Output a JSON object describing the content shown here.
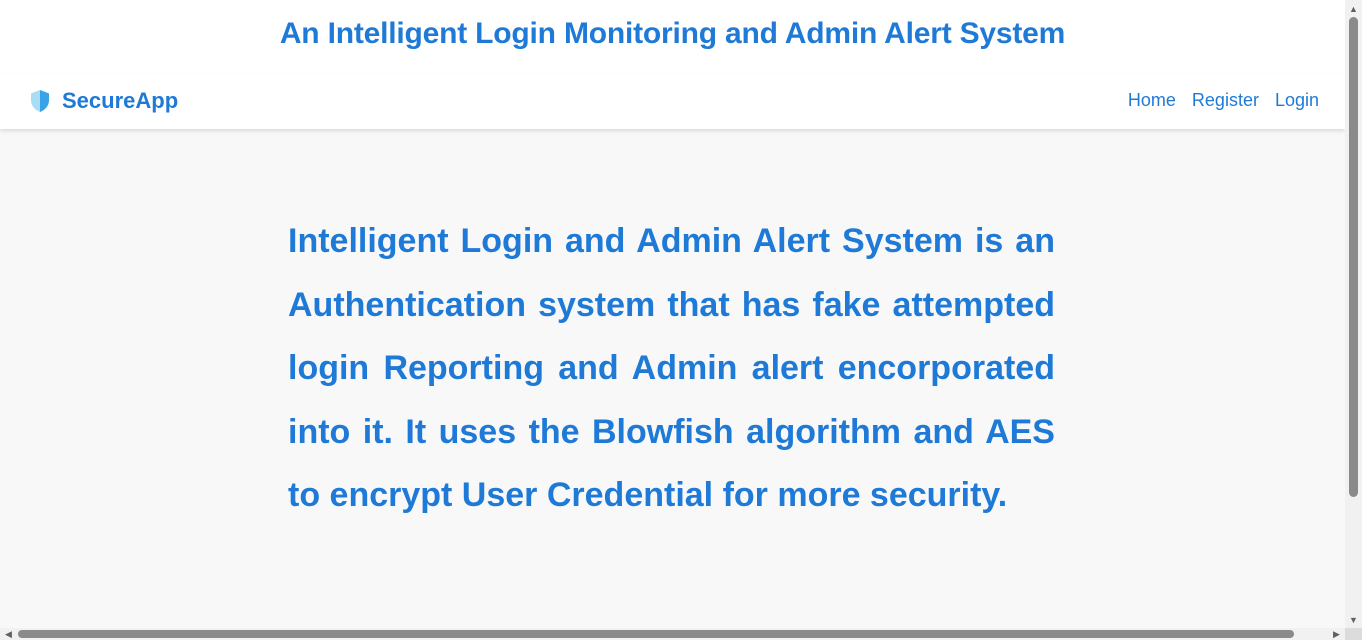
{
  "header": {
    "title": "An Intelligent Login Monitoring and Admin Alert System"
  },
  "navbar": {
    "brand_icon": "shield-icon",
    "brand_name": "SecureApp",
    "links": [
      {
        "label": "Home"
      },
      {
        "label": "Register"
      },
      {
        "label": "Login"
      }
    ]
  },
  "main": {
    "description": "Intelligent Login and Admin Alert System is an Authentication system that has fake attempted login Reporting and Admin alert encorporated into it. It uses the Blowfish algorithm and AES to encrypt User Credential for more security."
  },
  "colors": {
    "primary": "#1e7ad6",
    "background": "#f8f8f8",
    "surface": "#ffffff"
  }
}
